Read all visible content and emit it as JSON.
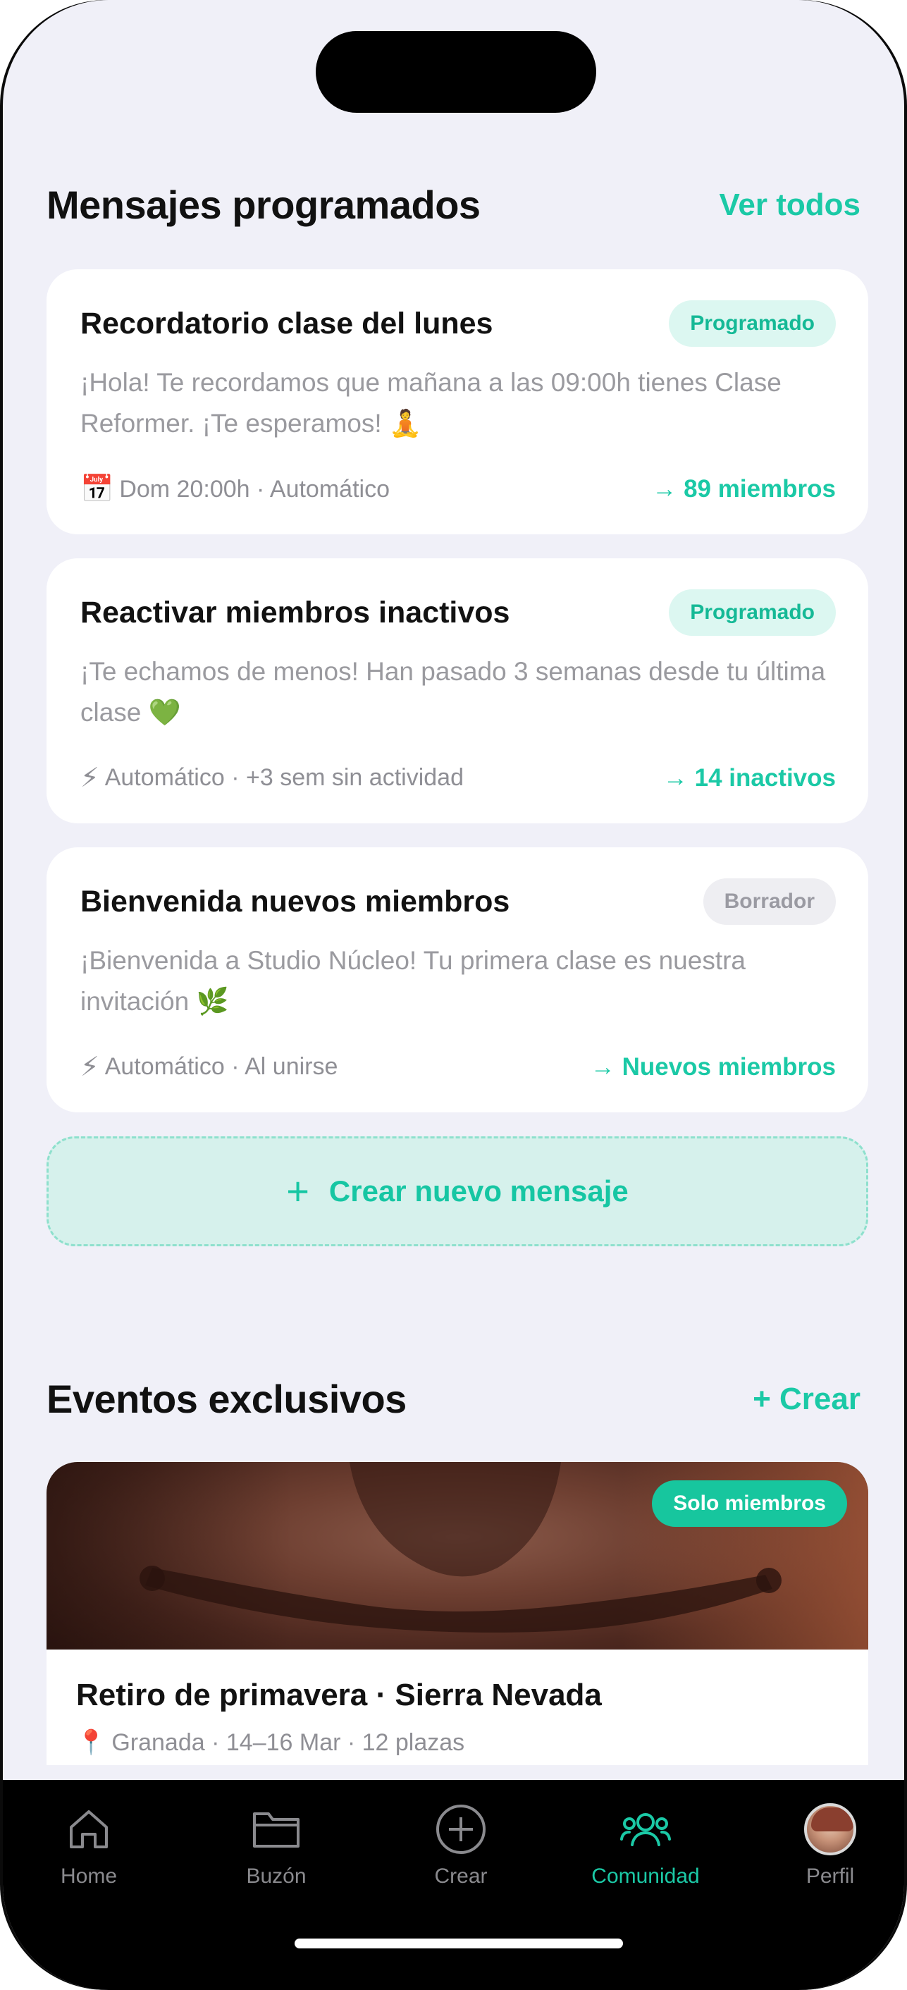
{
  "scheduled": {
    "title": "Mensajes programados",
    "view_all": "Ver todos",
    "messages": [
      {
        "title": "Recordatorio clase del lunes",
        "status": "Programado",
        "body": "¡Hola! Te recordamos que mañana a las 09:00h tienes Clase Reformer. ¡Te esperamos! 🧘",
        "meta_icon": "📅",
        "meta": "Dom 20:00h · Automático",
        "target": "→ 89 miembros"
      },
      {
        "title": "Reactivar miembros inactivos",
        "status": "Programado",
        "body": "¡Te echamos de menos! Han pasado 3 semanas desde tu última clase 💚",
        "meta_icon": "⚡",
        "meta": "Automático · +3 sem sin actividad",
        "target": "→ 14 inactivos"
      },
      {
        "title": "Bienvenida nuevos miembros",
        "status": "Borrador",
        "body": "¡Bienvenida a Studio Núcleo! Tu primera clase es nuestra invitación 🌿",
        "meta_icon": "⚡",
        "meta": "Automático · Al unirse",
        "target": "→ Nuevos miembros"
      }
    ],
    "create_plus": "+",
    "create_label": "Crear nuevo mensaje"
  },
  "events": {
    "title": "Eventos exclusivos",
    "create": "+ Crear",
    "card": {
      "badge": "Solo miembros",
      "title": "Retiro de primavera · Sierra Nevada",
      "meta_icon": "📍",
      "meta": "Granada · 14–16 Mar · 12 plazas"
    }
  },
  "tabbar": {
    "items": [
      {
        "label": "Home",
        "icon": "home-icon"
      },
      {
        "label": "Buzón",
        "icon": "folder-icon"
      },
      {
        "label": "Crear",
        "icon": "plus-circle-icon"
      },
      {
        "label": "Comunidad",
        "icon": "community-icon",
        "active": true
      },
      {
        "label": "Perfil",
        "icon": "avatar"
      }
    ]
  },
  "colors": {
    "accent": "#1bc9a6",
    "background": "#f0f0f8",
    "badge_programado_bg": "#dcf7f1",
    "badge_borrador_bg": "#eeeef2"
  }
}
